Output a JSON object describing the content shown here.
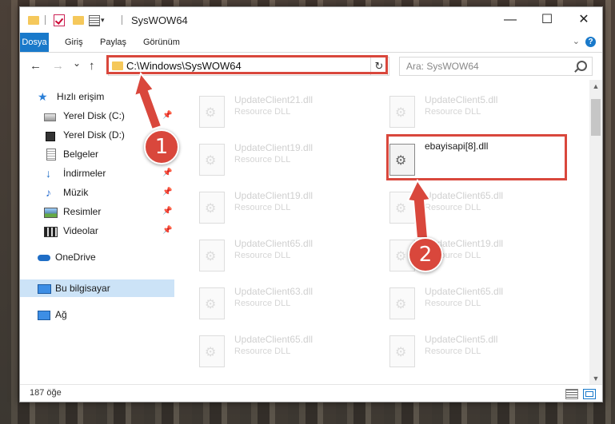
{
  "window": {
    "title": "SysWOW64",
    "minimize": "—",
    "maximize": "☐",
    "close": "✕"
  },
  "ribbon": {
    "tabs": [
      "Dosya",
      "Giriş",
      "Paylaş",
      "Görünüm"
    ]
  },
  "nav": {
    "back": "←",
    "forward": "→",
    "recent": "⌄",
    "up": "↑",
    "address": "C:\\Windows\\SysWOW64",
    "refresh": "↻",
    "search_placeholder": "Ara: SysWOW64"
  },
  "sidebar": {
    "quick_access": "Hızlı erişim",
    "items": [
      {
        "label": "Yerel Disk (C:)",
        "pinned": true
      },
      {
        "label": "Yerel Disk (D:)",
        "pinned": false
      },
      {
        "label": "Belgeler",
        "pinned": true
      },
      {
        "label": "İndirmeler",
        "pinned": true
      },
      {
        "label": "Müzik",
        "pinned": true
      },
      {
        "label": "Resimler",
        "pinned": true
      },
      {
        "label": "Videolar",
        "pinned": true
      }
    ],
    "onedrive": "OneDrive",
    "this_pc": "Bu bilgisayar",
    "network": "Ağ",
    "pin_glyph": "📌"
  },
  "files": {
    "left": [
      {
        "name": "UpdateClient21.dll",
        "type": "Resource DLL"
      },
      {
        "name": "UpdateClient19.dll",
        "type": "Resource DLL"
      },
      {
        "name": "UpdateClient19.dll",
        "type": "Resource DLL"
      },
      {
        "name": "UpdateClient65.dll",
        "type": "Resource DLL"
      },
      {
        "name": "UpdateClient63.dll",
        "type": "Resource DLL"
      },
      {
        "name": "UpdateClient65.dll",
        "type": "Resource DLL"
      }
    ],
    "right": [
      {
        "name": "UpdateClient5.dll",
        "type": "Resource DLL"
      },
      {
        "name": "ebayisapi[8].dll",
        "type": ""
      },
      {
        "name": "UpdateClient65.dll",
        "type": "Resource DLL"
      },
      {
        "name": "UpdateClient19.dll",
        "type": "Resource DLL"
      },
      {
        "name": "UpdateClient65.dll",
        "type": "Resource DLL"
      },
      {
        "name": "UpdateClient5.dll",
        "type": "Resource DLL"
      }
    ]
  },
  "status": {
    "count": "187 öğe"
  },
  "callouts": {
    "one": "1",
    "two": "2"
  },
  "colors": {
    "accent": "#1979ca",
    "highlight": "#d9473c"
  }
}
